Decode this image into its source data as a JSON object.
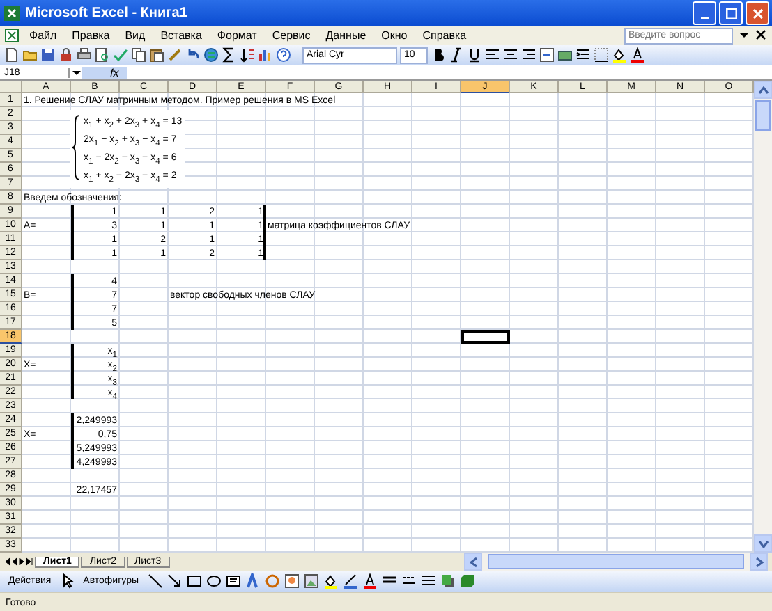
{
  "window": {
    "title": "Microsoft Excel - Книга1"
  },
  "menu": [
    "Файл",
    "Правка",
    "Вид",
    "Вставка",
    "Формат",
    "Сервис",
    "Данные",
    "Окно",
    "Справка"
  ],
  "help_box": {
    "placeholder": "Введите вопрос"
  },
  "formatting": {
    "font": "Arial Cyr",
    "size": "10"
  },
  "formula_bar": {
    "name_box": "J18",
    "fx": "fx"
  },
  "columns": [
    {
      "label": "A",
      "selected": false
    },
    {
      "label": "B",
      "selected": false
    },
    {
      "label": "C",
      "selected": false
    },
    {
      "label": "D",
      "selected": false
    },
    {
      "label": "E",
      "selected": false
    },
    {
      "label": "F",
      "selected": false
    },
    {
      "label": "G",
      "selected": false
    },
    {
      "label": "H",
      "selected": false
    },
    {
      "label": "I",
      "selected": false
    },
    {
      "label": "J",
      "selected": true
    },
    {
      "label": "K",
      "selected": false
    },
    {
      "label": "L",
      "selected": false
    },
    {
      "label": "M",
      "selected": false
    },
    {
      "label": "N",
      "selected": false
    },
    {
      "label": "O",
      "selected": false
    }
  ],
  "equation_object": {
    "lines": [
      "x$_{1}$ + x$_{2}$ + 2x$_{3}$ + x$_{4}$ = 13",
      "2x$_{1}$ − x$_{2}$ + x$_{3}$ − x$_{4}$ = 7",
      "x$_{1}$ − 2x$_{2}$ − x$_{3}$ − x$_{4}$ = 6",
      "x$_{1}$ + x$_{2}$ − 2x$_{3}$ − x$_{4}$ = 2"
    ]
  },
  "rows": [
    {
      "label": "1",
      "selected": false,
      "cells": {
        "A": {
          "kind": "text",
          "text": "1. Решение СЛАУ матричным методом. Пример решения в MS Excel"
        }
      }
    },
    {
      "label": "2",
      "selected": false,
      "cells": {}
    },
    {
      "label": "3",
      "selected": false,
      "cells": {}
    },
    {
      "label": "4",
      "selected": false,
      "cells": {}
    },
    {
      "label": "5",
      "selected": false,
      "cells": {}
    },
    {
      "label": "6",
      "selected": false,
      "cells": {}
    },
    {
      "label": "7",
      "selected": false,
      "cells": {}
    },
    {
      "label": "8",
      "selected": false,
      "cells": {
        "A": {
          "kind": "text",
          "text": "Введем обозначения:"
        }
      }
    },
    {
      "label": "9",
      "selected": false,
      "left_border": true,
      "right_border": true,
      "cells": {
        "B": {
          "kind": "number",
          "text": "1"
        },
        "C": {
          "kind": "number",
          "text": "1"
        },
        "D": {
          "kind": "number",
          "text": "2"
        },
        "E": {
          "kind": "number",
          "text": "1"
        }
      }
    },
    {
      "label": "10",
      "selected": false,
      "left_border": true,
      "right_border": true,
      "cells": {
        "A": {
          "kind": "text",
          "text": "A="
        },
        "B": {
          "kind": "number",
          "text": "3"
        },
        "C": {
          "kind": "number",
          "text": "1"
        },
        "D": {
          "kind": "number",
          "text": "1"
        },
        "E": {
          "kind": "number",
          "text": "1"
        },
        "F": {
          "kind": "text",
          "text": "матрица коэффициентов СЛАУ"
        }
      }
    },
    {
      "label": "11",
      "selected": false,
      "left_border": true,
      "right_border": true,
      "cells": {
        "B": {
          "kind": "number",
          "text": "1"
        },
        "C": {
          "kind": "number",
          "text": "2"
        },
        "D": {
          "kind": "number",
          "text": "1"
        },
        "E": {
          "kind": "number",
          "text": "1"
        }
      }
    },
    {
      "label": "12",
      "selected": false,
      "left_border": true,
      "right_border": true,
      "cells": {
        "B": {
          "kind": "number",
          "text": "1"
        },
        "C": {
          "kind": "number",
          "text": "1"
        },
        "D": {
          "kind": "number",
          "text": "2"
        },
        "E": {
          "kind": "number",
          "text": "1"
        }
      }
    },
    {
      "label": "13",
      "selected": false,
      "cells": {}
    },
    {
      "label": "14",
      "selected": false,
      "left_border": true,
      "cells": {
        "B": {
          "kind": "number",
          "text": "4"
        }
      }
    },
    {
      "label": "15",
      "selected": false,
      "left_border": true,
      "cells": {
        "A": {
          "kind": "text",
          "text": "B="
        },
        "B": {
          "kind": "number",
          "text": "7"
        },
        "D": {
          "kind": "text",
          "text": "вектор свободных членов СЛАУ"
        }
      }
    },
    {
      "label": "16",
      "selected": false,
      "left_border": true,
      "cells": {
        "B": {
          "kind": "number",
          "text": "7"
        }
      }
    },
    {
      "label": "17",
      "selected": false,
      "left_border": true,
      "cells": {
        "B": {
          "kind": "number",
          "text": "5"
        }
      }
    },
    {
      "label": "18",
      "selected": true,
      "cells": {}
    },
    {
      "label": "19",
      "selected": false,
      "left_border": true,
      "cells": {
        "B": {
          "kind": "variable",
          "text": "x$_{1}$"
        }
      }
    },
    {
      "label": "20",
      "selected": false,
      "left_border": true,
      "cells": {
        "A": {
          "kind": "text",
          "text": "X="
        },
        "B": {
          "kind": "variable",
          "text": "x$_{2}$"
        }
      }
    },
    {
      "label": "21",
      "selected": false,
      "left_border": true,
      "cells": {
        "B": {
          "kind": "variable",
          "text": "x$_{3}$"
        }
      }
    },
    {
      "label": "22",
      "selected": false,
      "left_border": true,
      "cells": {
        "B": {
          "kind": "variable",
          "text": "x$_{4}$"
        }
      }
    },
    {
      "label": "23",
      "selected": false,
      "cells": {}
    },
    {
      "label": "24",
      "selected": false,
      "left_border": true,
      "cells": {
        "B": {
          "kind": "number",
          "text": "2,249993"
        }
      }
    },
    {
      "label": "25",
      "selected": false,
      "left_border": true,
      "cells": {
        "A": {
          "kind": "text",
          "text": "X="
        },
        "B": {
          "kind": "number",
          "text": "0,75"
        }
      }
    },
    {
      "label": "26",
      "selected": false,
      "left_border": true,
      "cells": {
        "B": {
          "kind": "number",
          "text": "5,249993"
        }
      }
    },
    {
      "label": "27",
      "selected": false,
      "left_border": true,
      "cells": {
        "B": {
          "kind": "number",
          "text": "4,249993"
        }
      }
    },
    {
      "label": "28",
      "selected": false,
      "cells": {}
    },
    {
      "label": "29",
      "selected": false,
      "cells": {
        "B": {
          "kind": "number",
          "text": "22,17457"
        }
      }
    },
    {
      "label": "30",
      "selected": false,
      "cells": {}
    },
    {
      "label": "31",
      "selected": false,
      "cells": {}
    },
    {
      "label": "32",
      "selected": false,
      "cells": {}
    },
    {
      "label": "33",
      "selected": false,
      "cells": {}
    }
  ],
  "sheet_tabs": [
    {
      "label": "Лист1",
      "selected": true
    },
    {
      "label": "Лист2",
      "selected": false
    },
    {
      "label": "Лист3",
      "selected": false
    }
  ],
  "drawing_toolbar": {
    "actions": "Действия",
    "autoshapes": "Автофигуры"
  },
  "status_bar": {
    "text": "Готово"
  }
}
